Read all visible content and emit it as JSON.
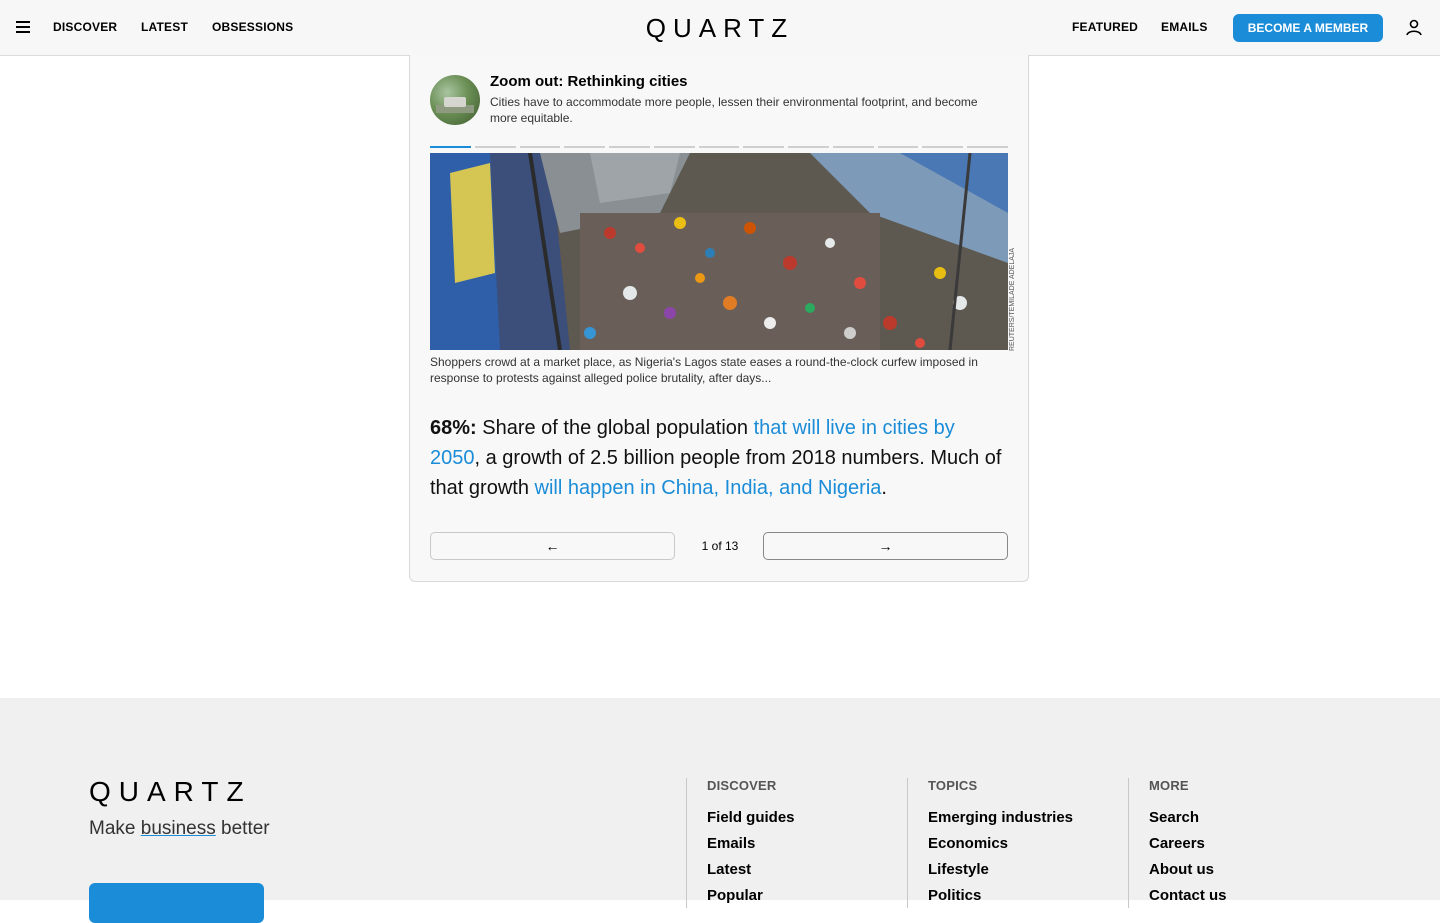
{
  "header": {
    "nav_left": [
      "DISCOVER",
      "LATEST",
      "OBSESSIONS"
    ],
    "logo": "QUARTZ",
    "nav_right": [
      "FEATURED",
      "EMAILS"
    ],
    "member_button": "BECOME A MEMBER",
    "menu_icon": "hamburger-icon",
    "user_icon": "user-icon",
    "accent_color": "#1a8cd8"
  },
  "card": {
    "title": "Zoom out: Rethinking cities",
    "subtitle": "Cities have to accommodate more people, lessen their environmental footprint, and become more equitable.",
    "slides_total": 13,
    "slide_current": 1,
    "photo_credit": "REUTERS/TEMILADE ADELAJA",
    "caption": "Shoppers crowd at a market place, as Nigeria's Lagos state eases a round-the-clock curfew imposed in response to protests against alleged police brutality, after days...",
    "stat_value": "68%:",
    "stat_text_1": " Share of the global population ",
    "stat_link_1": "that will live in cities by 2050",
    "stat_text_2": ", a growth of 2.5 billion people from 2018 numbers. Much of that growth ",
    "stat_link_2": "will happen in China, India, and Nigeria",
    "stat_text_3": ".",
    "prev_arrow": "←",
    "next_arrow": "→",
    "page_counter": "1 of 13"
  },
  "footer": {
    "logo": "QUARTZ",
    "tagline_before": "Make ",
    "tagline_underlined": "business",
    "tagline_after": " better",
    "columns": [
      {
        "heading": "DISCOVER",
        "links": [
          "Field guides",
          "Emails",
          "Latest",
          "Popular"
        ]
      },
      {
        "heading": "TOPICS",
        "links": [
          "Emerging industries",
          "Economics",
          "Lifestyle",
          "Politics"
        ]
      },
      {
        "heading": "MORE",
        "links": [
          "Search",
          "Careers",
          "About us",
          "Contact us"
        ]
      }
    ]
  }
}
